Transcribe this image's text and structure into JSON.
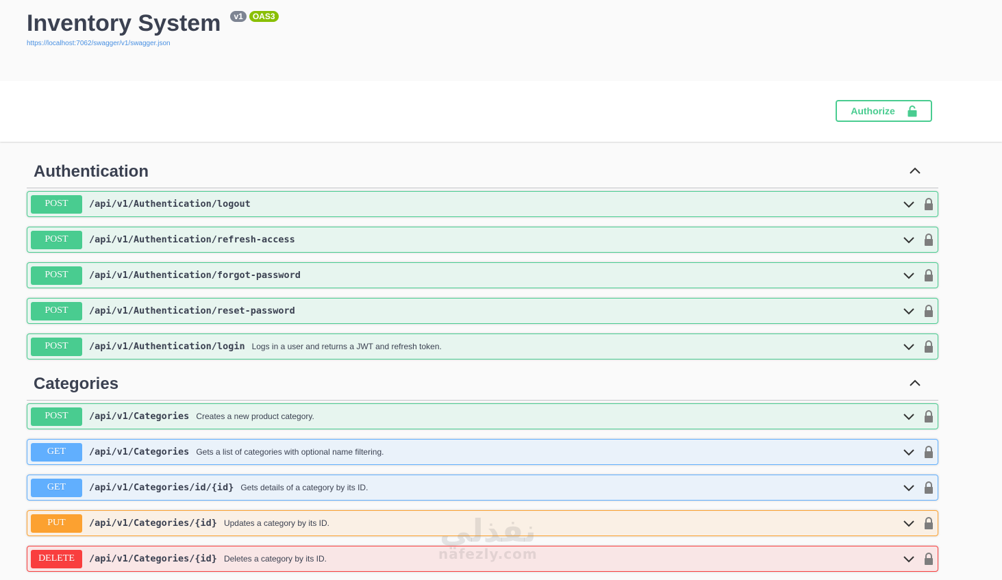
{
  "header": {
    "title": "Inventory System",
    "version_badge": "v1",
    "oas_badge": "OAS3",
    "spec_url": "https://localhost:7062/swagger/v1/swagger.json"
  },
  "scheme": {
    "authorize_label": "Authorize"
  },
  "sections": [
    {
      "title": "Authentication",
      "operations": [
        {
          "method": "POST",
          "path": "/api/v1/Authentication/logout",
          "summary": ""
        },
        {
          "method": "POST",
          "path": "/api/v1/Authentication/refresh-access",
          "summary": ""
        },
        {
          "method": "POST",
          "path": "/api/v1/Authentication/forgot-password",
          "summary": ""
        },
        {
          "method": "POST",
          "path": "/api/v1/Authentication/reset-password",
          "summary": ""
        },
        {
          "method": "POST",
          "path": "/api/v1/Authentication/login",
          "summary": "Logs in a user and returns a JWT and refresh token."
        }
      ]
    },
    {
      "title": "Categories",
      "operations": [
        {
          "method": "POST",
          "path": "/api/v1/Categories",
          "summary": "Creates a new product category."
        },
        {
          "method": "GET",
          "path": "/api/v1/Categories",
          "summary": "Gets a list of categories with optional name filtering."
        },
        {
          "method": "GET",
          "path": "/api/v1/Categories/id/{id}",
          "summary": "Gets details of a category by its ID."
        },
        {
          "method": "PUT",
          "path": "/api/v1/Categories/{id}",
          "summary": "Updates a category by its ID."
        },
        {
          "method": "DELETE",
          "path": "/api/v1/Categories/{id}",
          "summary": "Deletes a category by its ID."
        }
      ]
    }
  ],
  "watermark": {
    "arabic": "نفذلي",
    "latin": "nafezly.com"
  },
  "colors": {
    "post": "#49cc90",
    "get": "#61affe",
    "put": "#fca130",
    "delete": "#f93e3e",
    "link": "#4990e2"
  },
  "icons": {
    "section_toggle": "chevron-up-icon",
    "operation_toggle": "chevron-down-icon",
    "operation_lock": "lock-icon",
    "authorize_lock": "unlocked-icon"
  }
}
